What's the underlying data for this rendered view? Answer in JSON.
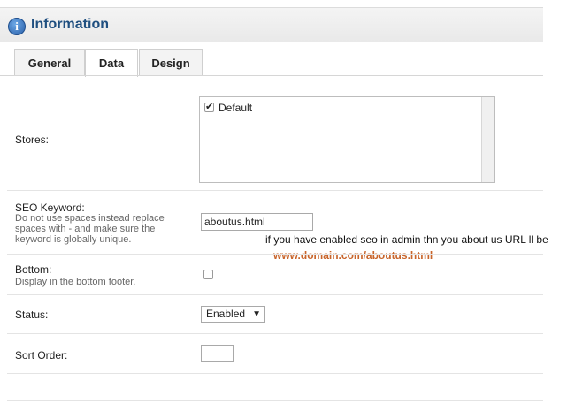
{
  "header": {
    "title": "Information",
    "icon": "info-icon"
  },
  "tabs": [
    {
      "label": "General"
    },
    {
      "label": "Data"
    },
    {
      "label": "Design"
    }
  ],
  "active_tab": "Data",
  "form": {
    "stores": {
      "label": "Stores:",
      "options": [
        {
          "label": "Default",
          "checked": true
        }
      ]
    },
    "seo": {
      "label": "SEO Keyword:",
      "hint_lines": [
        "Do not use spaces instead replace",
        "spaces with - and make sure the",
        "keyword is globally unique."
      ],
      "value": "aboutus.html"
    },
    "bottom": {
      "label": "Bottom:",
      "hint": "Display in the bottom footer.",
      "checked": false
    },
    "status": {
      "label": "Status:",
      "value": "Enabled"
    },
    "sort_order": {
      "label": "Sort Order:",
      "value": ""
    }
  },
  "annotation": {
    "text": "if you have enabled seo in admin thn you about us URL ll be",
    "url": "www.domain.com/aboutus.html",
    "url_color": "#c8642a"
  }
}
